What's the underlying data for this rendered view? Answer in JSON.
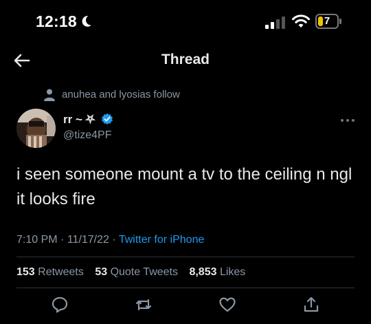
{
  "status_bar": {
    "time": "12:18",
    "battery_level": "7",
    "icons": [
      "moon-icon",
      "cellular-signal-icon",
      "wifi-icon",
      "battery-icon"
    ]
  },
  "header": {
    "title": "Thread",
    "back_icon": "arrow-left-icon"
  },
  "tweet": {
    "social_context": "anuhea and lyosias follow",
    "display_name": "rr ~ ⛧",
    "handle": "@tize4PF",
    "text": "i seen someone mount a tv to the ceiling n ngl it looks fire",
    "time": "7:10 PM",
    "date": "11/17/22",
    "separator": "·",
    "source": "Twitter for iPhone",
    "stats": {
      "retweets_count": "153",
      "retweets_label": "Retweets",
      "quotes_count": "53",
      "quotes_label": "Quote Tweets",
      "likes_count": "8,853",
      "likes_label": "Likes"
    },
    "actions": [
      "reply-icon",
      "retweet-icon",
      "like-icon",
      "share-icon"
    ]
  },
  "colors": {
    "background": "#000000",
    "primary_text": "#e7e9ea",
    "secondary_text": "#8b98a5",
    "link": "#1d9bf0",
    "verified": "#1d9bf0",
    "battery_low": "#f2c200"
  }
}
